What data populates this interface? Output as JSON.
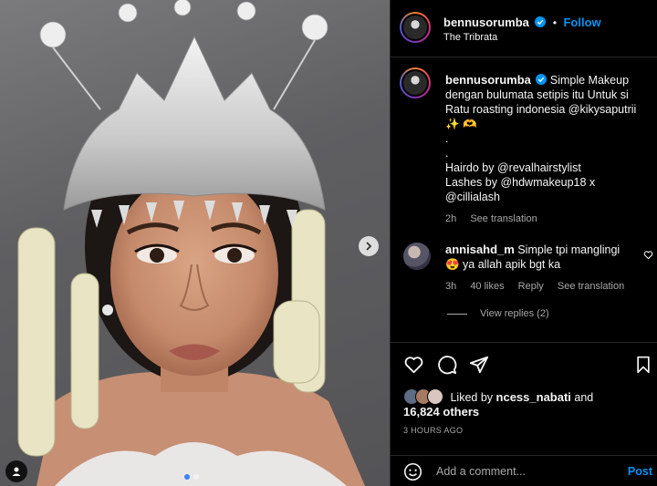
{
  "header": {
    "username": "bennusorumba",
    "follow_label": "Follow",
    "location": "The Tribrata",
    "separator": "•"
  },
  "caption": {
    "username": "bennusorumba",
    "lines": [
      "Simple Makeup",
      "dengan bulumata setipis itu Untuk si",
      "Ratu roasting indonesia @kikysaputrii",
      "✨ 🫶",
      ".",
      ".",
      "Hairdo by @revalhairstylist",
      "Lashes by @hdwmakeup18 x",
      "@cillialash"
    ],
    "time": "2h",
    "see_translation": "See translation"
  },
  "comment": {
    "username": "annisahd_m",
    "text_line1": "Simple tpi manglingi",
    "text_line2": "😍 ya allah apik bgt ka",
    "time": "3h",
    "likes": "40 likes",
    "reply": "Reply",
    "see_translation": "See translation",
    "view_replies": "View replies (2)"
  },
  "likes": {
    "prefix": "Liked by",
    "user": "ncess_nabati",
    "and": "and",
    "others": "16,824 others"
  },
  "timestamp": "3 HOURS AGO",
  "add_comment": {
    "placeholder": "Add a comment...",
    "post_label": "Post"
  },
  "icons": {
    "like": "heart-icon",
    "comment": "comment-icon",
    "share": "paper-plane-icon",
    "save": "bookmark-icon",
    "emoji": "smiley-icon",
    "verified": "verified-badge-icon",
    "next": "chevron-right-icon",
    "tag": "person-tag-icon"
  },
  "colors": {
    "accent": "#0095f6",
    "carousel_active": "#3b82f6",
    "background": "#000000",
    "secondary_text": "#a8a8a8"
  },
  "carousel": {
    "total": 2,
    "active": 1
  }
}
